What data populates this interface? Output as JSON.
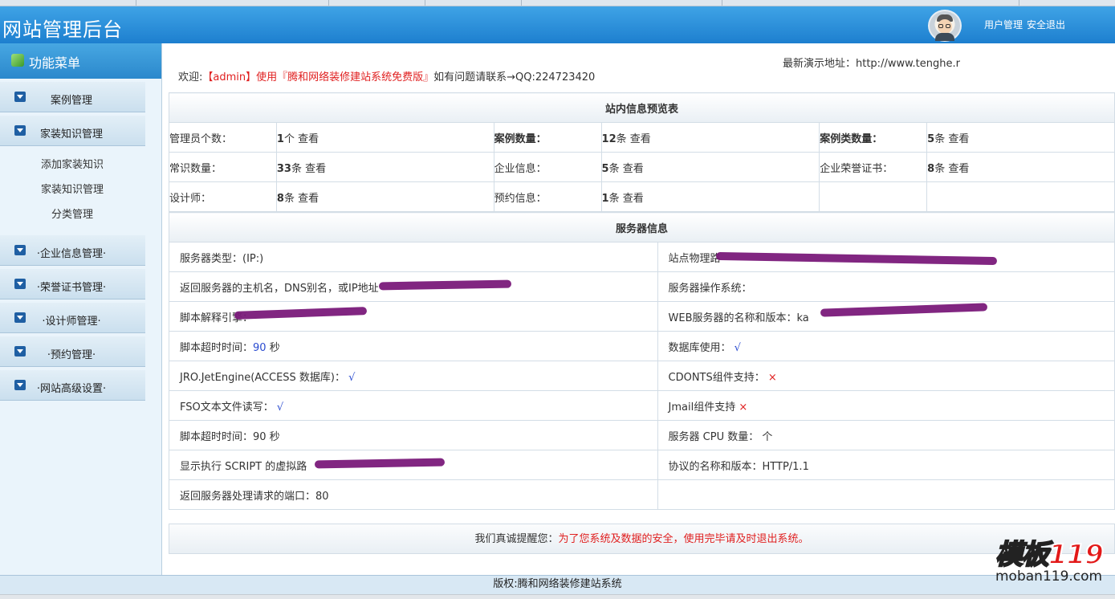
{
  "header": {
    "title": "网站管理后台",
    "user_admin": "用户管理",
    "logout": "安全退出"
  },
  "sidebar": {
    "title": "功能菜单",
    "items": [
      {
        "label": "案例管理"
      },
      {
        "label": "家装知识管理",
        "children": [
          "添加家装知识",
          "家装知识管理",
          "分类管理"
        ]
      },
      {
        "label": "·企业信息管理·"
      },
      {
        "label": "·荣誉证书管理·"
      },
      {
        "label": "·设计师管理·"
      },
      {
        "label": "·预约管理·"
      },
      {
        "label": "·网站高级设置·"
      }
    ]
  },
  "main": {
    "welcome_prefix": "欢迎:",
    "welcome_red": "【admin】使用『腾和网络装修建站系统免费版』",
    "welcome_suffix": "如有问题请联系→QQ:224723420",
    "demo_address": "最新演示地址：http://www.tenghe.r",
    "site_info": {
      "title": "站内信息预览表",
      "rows": [
        [
          {
            "label": "管理员个数：",
            "count": "1",
            "unit": "个",
            "link": "查看"
          },
          {
            "label": "案例数量：",
            "count": "12",
            "unit": "条",
            "link": "查看",
            "bold": true
          },
          {
            "label": "案例类数量：",
            "count": "5",
            "unit": "条",
            "link": "查看",
            "bold": true
          }
        ],
        [
          {
            "label": "常识数量：",
            "count": "33",
            "unit": "条",
            "link": "查看"
          },
          {
            "label": "企业信息：",
            "count": "5",
            "unit": "条",
            "link": "查看"
          },
          {
            "label": "企业荣誉证书：",
            "count": "8",
            "unit": "条",
            "link": "查看"
          }
        ],
        [
          {
            "label": "设计师：",
            "count": "8",
            "unit": "条",
            "link": "查看"
          },
          {
            "label": "预约信息：",
            "count": "1",
            "unit": "条",
            "link": "查看"
          }
        ]
      ]
    },
    "server_info": {
      "title": "服务器信息",
      "rows": [
        [
          "服务器类型：(IP:)",
          "站点物理路"
        ],
        [
          "返回服务器的主机名，DNS别名，或IP地址",
          "服务器操作系统："
        ],
        [
          "脚本解释引擎：",
          "WEB服务器的名称和版本：ka"
        ],
        [
          "脚本超时时间：",
          "数据库使用："
        ],
        [
          "JRO.JetEngine(ACCESS 数据库)：",
          "CDONTS组件支持："
        ],
        [
          "FSO文本文件读写：",
          "Jmail组件支持"
        ],
        [
          "脚本超时时间：90 秒",
          "服务器 CPU 数量： 个"
        ],
        [
          "显示执行 SCRIPT 的虚拟路",
          "协议的名称和版本：HTTP/1.1"
        ],
        [
          "返回服务器处理请求的端口：80",
          ""
        ]
      ],
      "timeout_value": "90",
      "timeout_unit": "秒",
      "check": "√",
      "cross": "×"
    },
    "notice_prefix": "我们真诚提醒您：",
    "notice_red": "为了您系统及数据的安全，使用完毕请及时退出系统。"
  },
  "footer": "版权:腾和网络装修建站系统",
  "watermark": {
    "text": "模板",
    "number": "119",
    "url": "moban119.com"
  }
}
